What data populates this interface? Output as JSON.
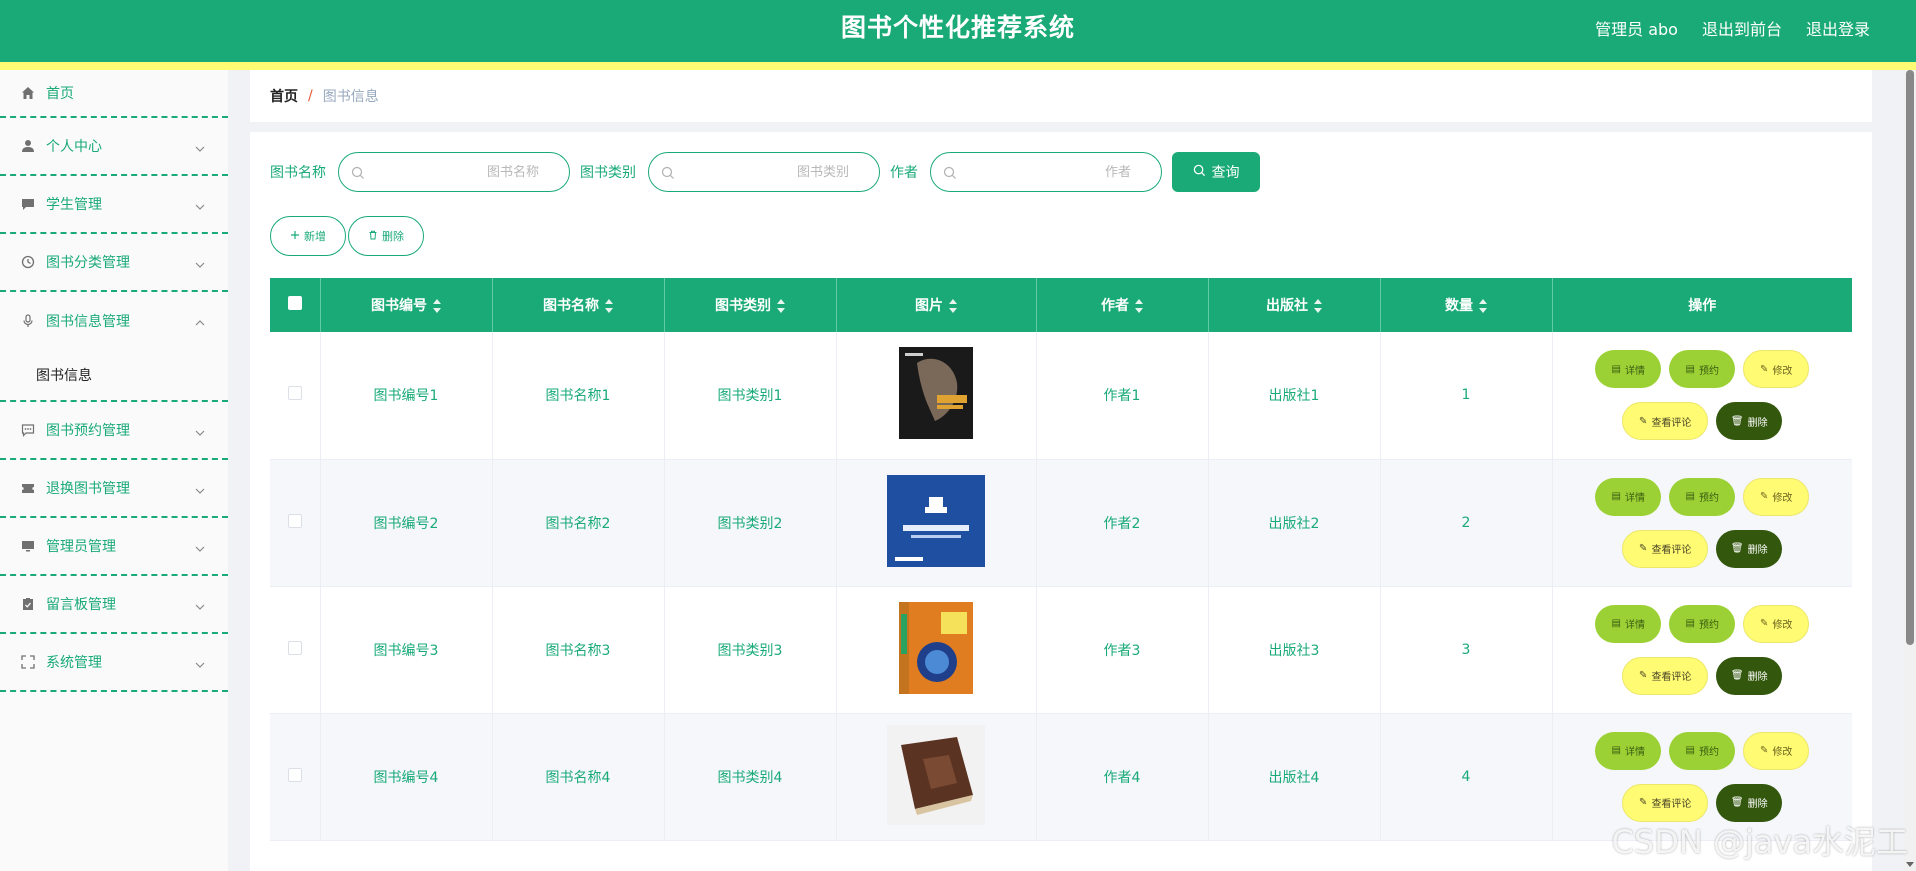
{
  "header": {
    "title": "图书个性化推荐系统",
    "user_label": "管理员 abo",
    "front_link": "退出到前台",
    "logout_link": "退出登录",
    "colors": {
      "primary": "#1aaa78",
      "accent": "#fffb72"
    }
  },
  "sidebar": {
    "items": [
      {
        "label": "首页",
        "icon": "home-icon"
      },
      {
        "label": "个人中心",
        "icon": "user-icon"
      },
      {
        "label": "学生管理",
        "icon": "chat-icon"
      },
      {
        "label": "图书分类管理",
        "icon": "clock-icon"
      },
      {
        "label": "图书信息管理",
        "icon": "microphone-icon",
        "open": true,
        "children": [
          "图书信息"
        ]
      },
      {
        "label": "图书预约管理",
        "icon": "message-icon"
      },
      {
        "label": "退换图书管理",
        "icon": "ticket-icon"
      },
      {
        "label": "管理员管理",
        "icon": "monitor-icon"
      },
      {
        "label": "留言板管理",
        "icon": "clipboard-icon"
      },
      {
        "label": "系统管理",
        "icon": "fullscreen-icon"
      }
    ]
  },
  "breadcrumb": {
    "home": "首页",
    "separator": "/",
    "current": "图书信息"
  },
  "search": {
    "name_label": "图书名称",
    "name_placeholder": "图书名称",
    "category_label": "图书类别",
    "category_placeholder": "图书类别",
    "author_label": "作者",
    "author_placeholder": "作者",
    "query_button": "查询"
  },
  "actions": {
    "add": "新增",
    "delete": "删除"
  },
  "table": {
    "columns": [
      "图书编号",
      "图书名称",
      "图书类别",
      "图片",
      "作者",
      "出版社",
      "数量",
      "操作"
    ],
    "row_actions": {
      "detail": "详情",
      "reserve": "预约",
      "edit": "修改",
      "comments": "查看评论",
      "delete": "删除"
    },
    "rows": [
      {
        "id": "图书编号1",
        "name": "图书名称1",
        "category": "图书类别1",
        "cover": "book-cover-dark",
        "author": "作者1",
        "publisher": "出版社1",
        "quantity": "1"
      },
      {
        "id": "图书编号2",
        "name": "图书名称2",
        "category": "图书类别2",
        "cover": "book-cover-blue",
        "author": "作者2",
        "publisher": "出版社2",
        "quantity": "2"
      },
      {
        "id": "图书编号3",
        "name": "图书名称3",
        "category": "图书类别3",
        "cover": "book-cover-orange",
        "author": "作者3",
        "publisher": "出版社3",
        "quantity": "3"
      },
      {
        "id": "图书编号4",
        "name": "图书名称4",
        "category": "图书类别4",
        "cover": "book-cover-leather",
        "author": "作者4",
        "publisher": "出版社4",
        "quantity": "4"
      }
    ]
  },
  "watermark": "CSDN @java水泥工"
}
